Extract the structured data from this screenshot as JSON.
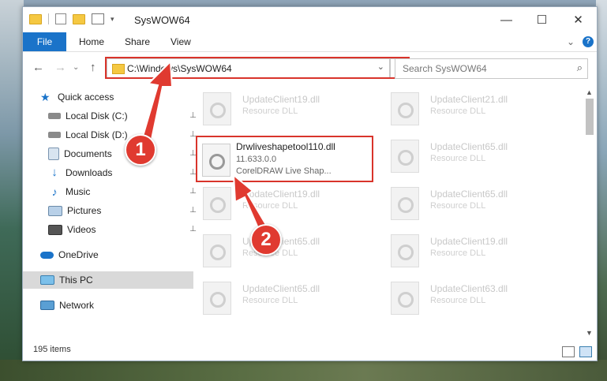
{
  "window": {
    "title": "SysWOW64",
    "minimize": "—",
    "maximize": "☐",
    "close": "✕"
  },
  "ribbon": {
    "tabs": [
      "File",
      "Home",
      "Share",
      "View"
    ],
    "collapse": "⌄",
    "help": "?"
  },
  "nav": {
    "back": "←",
    "forward": "→",
    "recent": "⌄",
    "up": "↑",
    "address": "C:\\Windows\\SysWOW64",
    "address_dropdown": "⌄",
    "refresh": "↻",
    "search_placeholder": "Search SysWOW64",
    "search_icon": "⌕"
  },
  "sidebar": {
    "items": [
      {
        "label": "Quick access",
        "icon": "star-icon",
        "pinned": false
      },
      {
        "label": "Local Disk (C:)",
        "icon": "drive-icon",
        "pinned": true
      },
      {
        "label": "Local Disk (D:)",
        "icon": "drive-icon",
        "pinned": true
      },
      {
        "label": "Documents",
        "icon": "documents-icon",
        "pinned": true
      },
      {
        "label": "Downloads",
        "icon": "downloads-icon",
        "pinned": true
      },
      {
        "label": "Music",
        "icon": "music-icon",
        "pinned": true
      },
      {
        "label": "Pictures",
        "icon": "pictures-icon",
        "pinned": true
      },
      {
        "label": "Videos",
        "icon": "videos-icon",
        "pinned": true
      },
      {
        "label": "OneDrive",
        "icon": "cloud-icon",
        "pinned": false
      },
      {
        "label": "This PC",
        "icon": "computer-icon",
        "pinned": false
      },
      {
        "label": "Network",
        "icon": "network-icon",
        "pinned": false
      }
    ],
    "pin_glyph": "📌"
  },
  "files": [
    {
      "name": "UpdateClient19.dll",
      "type": "Resource DLL"
    },
    {
      "name": "UpdateClient21.dll",
      "type": "Resource DLL"
    },
    {
      "name": "UpdateClient65.dll",
      "type": "Resource DLL"
    },
    {
      "name": "UpdateClient19.dll",
      "type": "Resource DLL"
    },
    {
      "name": "UpdateClient65.dll",
      "type": "Resource DLL"
    },
    {
      "name": "UpdateClient65.dll",
      "type": "Resource DLL"
    },
    {
      "name": "UpdateClient19.dll",
      "type": "Resource DLL"
    },
    {
      "name": "UpdateClient65.dll",
      "type": "Resource DLL"
    },
    {
      "name": "UpdateClient63.dll",
      "type": "Resource DLL"
    }
  ],
  "selected_file": {
    "name": "Drwliveshapetool110.dll",
    "version": "11.633.0.0",
    "description": "CorelDRAW Live Shap..."
  },
  "status": {
    "count": "195 items"
  },
  "callouts": [
    "1",
    "2"
  ],
  "colors": {
    "accent": "#1a73c9",
    "highlight": "#d9342b",
    "selected_row": "#d9d9d9"
  }
}
